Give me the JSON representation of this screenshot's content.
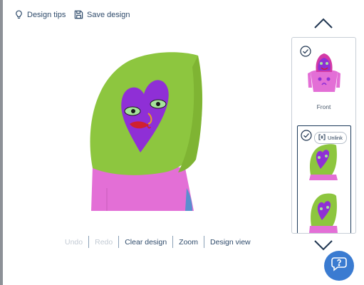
{
  "toolbar": {
    "design_tips": "Design tips",
    "save_design": "Save design"
  },
  "bottom_bar": {
    "undo": "Undo",
    "redo": "Redo",
    "clear_design": "Clear design",
    "zoom": "Zoom",
    "design_view": "Design view"
  },
  "thumbnails": {
    "front_label": "Front",
    "unlink_label": "Unlink"
  },
  "colors": {
    "hood_green": "#8dc63f",
    "body_pink": "#e36fd6",
    "accent_purple": "#7b2bc4",
    "brand_blue": "#3a7bd1"
  },
  "icons": {
    "tips": "lightbulb-icon",
    "save": "floppy-disk-icon",
    "up": "chevron-up-icon",
    "down": "chevron-down-icon",
    "check": "check-circle-icon",
    "help": "chat-help-icon",
    "unlink": "unlink-icon"
  }
}
